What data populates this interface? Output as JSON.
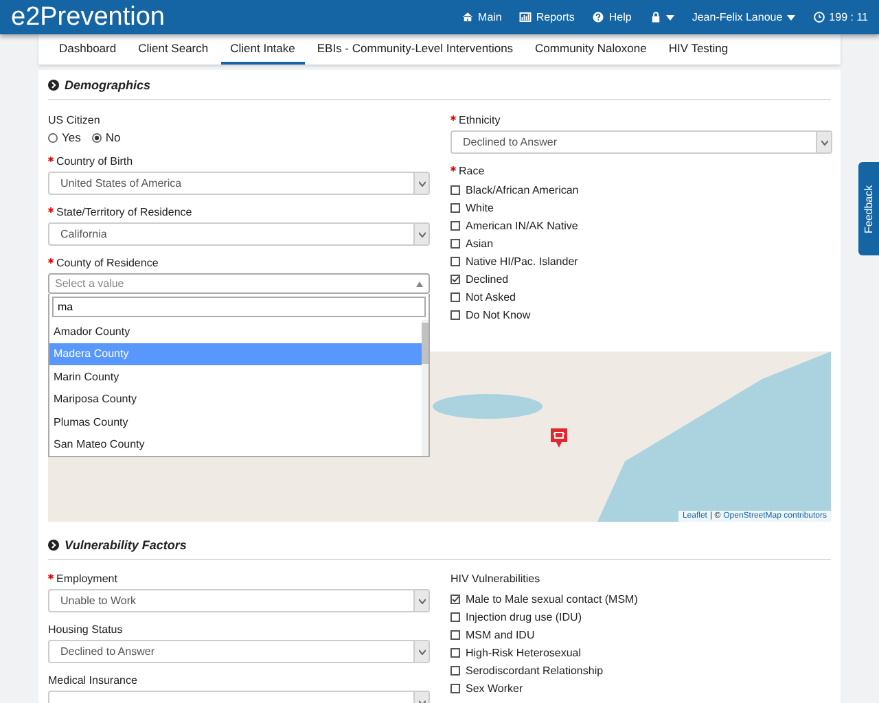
{
  "header": {
    "brand": "e2Prevention",
    "nav": [
      {
        "kind": "home",
        "label": "Main"
      },
      {
        "kind": "chart",
        "label": "Reports"
      },
      {
        "kind": "help",
        "label": "Help"
      },
      {
        "kind": "lock"
      }
    ],
    "user": "Jean-Felix Lanoue",
    "timer": "199 : 11"
  },
  "tabs": [
    {
      "label": "Dashboard",
      "selected": false
    },
    {
      "label": "Client Search",
      "selected": false
    },
    {
      "label": "Client Intake",
      "selected": true
    },
    {
      "label": "EBIs - Community-Level Interventions",
      "selected": false
    },
    {
      "label": "Community Naloxone",
      "selected": false
    },
    {
      "label": "HIV Testing",
      "selected": false
    }
  ],
  "demographics": {
    "title": "Demographics",
    "us_citizen": {
      "label": "US Citizen",
      "options": [
        {
          "label": "Yes",
          "selected": false
        },
        {
          "label": "No",
          "selected": true
        }
      ]
    },
    "country_of_birth": {
      "label": "Country of Birth",
      "required": true,
      "value": "United States of America"
    },
    "state": {
      "label": "State/Territory of Residence",
      "required": true,
      "value": "California"
    },
    "county": {
      "label": "County of Residence",
      "required": true,
      "placeholder": "Select a value",
      "search": "ma",
      "options": [
        {
          "label": "Amador County",
          "selected": false
        },
        {
          "label": "Madera County",
          "selected": true
        },
        {
          "label": "Marin County",
          "selected": false
        },
        {
          "label": "Mariposa County",
          "selected": false
        },
        {
          "label": "Plumas County",
          "selected": false
        },
        {
          "label": "San Mateo County",
          "selected": false
        }
      ]
    },
    "ethnicity": {
      "label": "Ethnicity",
      "required": true,
      "value": "Declined to Answer"
    },
    "race": {
      "label": "Race",
      "required": true,
      "options": [
        {
          "label": "Black/African American",
          "checked": false
        },
        {
          "label": "White",
          "checked": false
        },
        {
          "label": "American IN/AK Native",
          "checked": false
        },
        {
          "label": "Asian",
          "checked": false
        },
        {
          "label": "Native HI/Pac. Islander",
          "checked": false
        },
        {
          "label": "Declined",
          "checked": true
        },
        {
          "label": "Not Asked",
          "checked": false
        },
        {
          "label": "Do Not Know",
          "checked": false
        }
      ]
    },
    "map": {
      "attribution_link": "Leaflet",
      "attribution_text": "| ©",
      "attribution_source": "OpenStreetMap contributors"
    }
  },
  "vulnerability": {
    "title": "Vulnerability Factors",
    "fields": [
      {
        "label": "Employment",
        "required": true,
        "value": "Unable to Work"
      },
      {
        "label": "Housing Status",
        "required": false,
        "value": "Declined to Answer"
      },
      {
        "label": "Medical Insurance",
        "required": false
      }
    ],
    "hiv": {
      "label": "HIV Vulnerabilities",
      "options": [
        {
          "label": "Male to Male sexual contact (MSM)",
          "checked": true
        },
        {
          "label": "Injection drug use (IDU)",
          "checked": false
        },
        {
          "label": "MSM and IDU",
          "checked": false
        },
        {
          "label": "High-Risk Heterosexual",
          "checked": false
        },
        {
          "label": "Serodiscordant Relationship",
          "checked": false
        },
        {
          "label": "Sex Worker",
          "checked": false
        }
      ]
    }
  },
  "feedback": "Feedback"
}
